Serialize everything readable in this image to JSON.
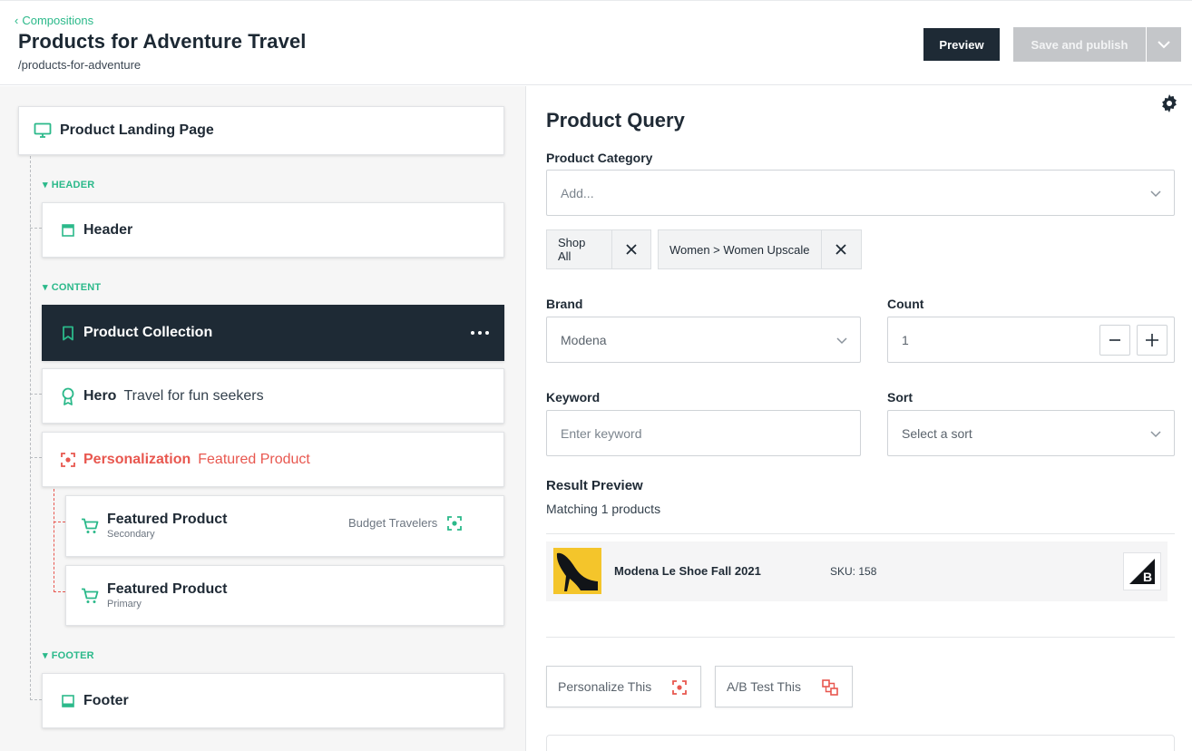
{
  "header": {
    "breadcrumb": "Compositions",
    "title": "Products for Adventure Travel",
    "slug": "/products-for-adventure",
    "preview_label": "Preview",
    "publish_label": "Save and publish"
  },
  "tree": {
    "root": "Product Landing Page",
    "sections": {
      "header": "HEADER",
      "content": "CONTENT",
      "footer": "FOOTER"
    },
    "header_item": "Header",
    "product_collection": "Product Collection",
    "hero": {
      "label": "Hero",
      "sub": "Travel for fun seekers"
    },
    "personalization": {
      "label": "Personalization",
      "sub": "Featured Product"
    },
    "featured_1": {
      "label": "Featured Product",
      "sub": "Secondary",
      "tag": "Budget Travelers"
    },
    "featured_2": {
      "label": "Featured Product",
      "sub": "Primary"
    },
    "footer_item": "Footer"
  },
  "panel": {
    "title": "Product Query",
    "category_label": "Product Category",
    "category_placeholder": "Add...",
    "chips": [
      "Shop All",
      "Women > Women Upscale"
    ],
    "brand_label": "Brand",
    "brand_value": "Modena",
    "count_label": "Count",
    "count_value": "1",
    "keyword_label": "Keyword",
    "keyword_placeholder": "Enter keyword",
    "sort_label": "Sort",
    "sort_placeholder": "Select a sort",
    "result_label": "Result Preview",
    "matching_text": "Matching 1 products",
    "result": {
      "name": "Modena Le Shoe Fall 2021",
      "sku": "SKU: 158"
    },
    "personalize_label": "Personalize This",
    "abtest_label": "A/B Test This"
  },
  "colors": {
    "accent_green": "#2bb98a",
    "dark": "#1e2a35",
    "personalization_red": "#e8574f"
  }
}
